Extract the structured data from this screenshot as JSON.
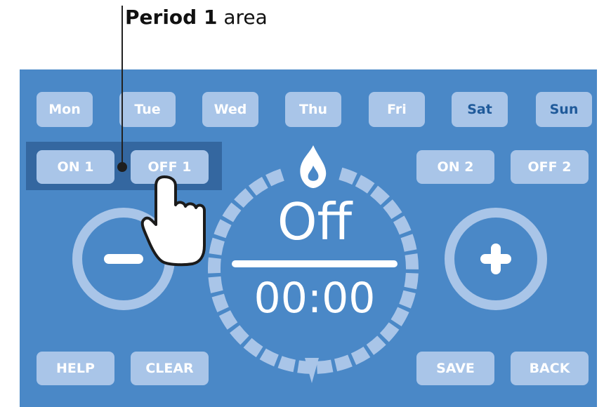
{
  "annotation": {
    "bold": "Period 1",
    "rest": " area"
  },
  "days": [
    {
      "label": "Mon",
      "selected": false
    },
    {
      "label": "Tue",
      "selected": false
    },
    {
      "label": "Wed",
      "selected": false
    },
    {
      "label": "Thu",
      "selected": false
    },
    {
      "label": "Fri",
      "selected": false
    },
    {
      "label": "Sat",
      "selected": true
    },
    {
      "label": "Sun",
      "selected": true
    }
  ],
  "period1": {
    "on_label": "ON 1",
    "off_label": "OFF 1"
  },
  "period2": {
    "on_label": "ON 2",
    "off_label": "OFF 2"
  },
  "display": {
    "state": "Off",
    "time": "00:00"
  },
  "icons": {
    "minus": "minus-icon",
    "plus": "plus-icon",
    "flame": "flame-icon",
    "pointer": "hand-pointer-icon"
  },
  "bottom": {
    "help_label": "HELP",
    "clear_label": "CLEAR",
    "save_label": "SAVE",
    "back_label": "BACK"
  },
  "colors": {
    "panel": "#4a88c7",
    "button": "#a9c5e8",
    "period_area": "#3467a0",
    "selected_text": "#1f5a9a"
  }
}
